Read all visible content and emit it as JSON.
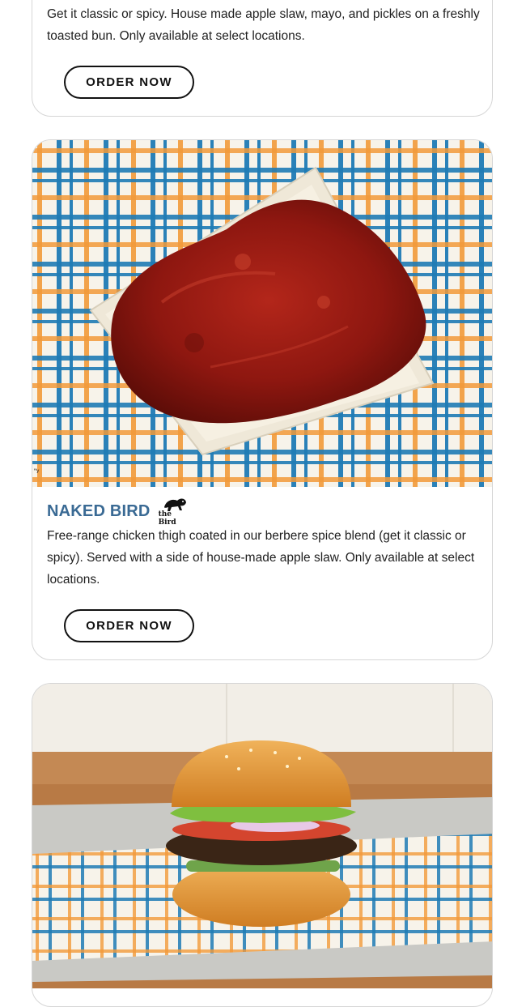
{
  "cards": [
    {
      "description": "Get it classic or spicy. House made apple slaw, mayo, and pickles on a freshly toasted bun. Only available at select locations.",
      "button_label": "ORDER NOW"
    },
    {
      "title": "NAKED BIRD",
      "badge_text": "the Bird",
      "photo_mark": "\"ʸ",
      "description": "Free-range chicken thigh coated in our berbere spice blend (get it classic or spicy). Served with a side of house-made apple slaw. Only available at select locations.",
      "button_label": "ORDER NOW"
    },
    {}
  ],
  "colors": {
    "title_blue": "#3a6a94",
    "plaid_blue": "#1f7bb5",
    "plaid_orange": "#f29a3a",
    "sauce_red": "#9a1a12",
    "button_border": "#111111",
    "card_border": "#d6d6d6"
  },
  "icons": {
    "badge_icon": "bird-logo-icon"
  }
}
